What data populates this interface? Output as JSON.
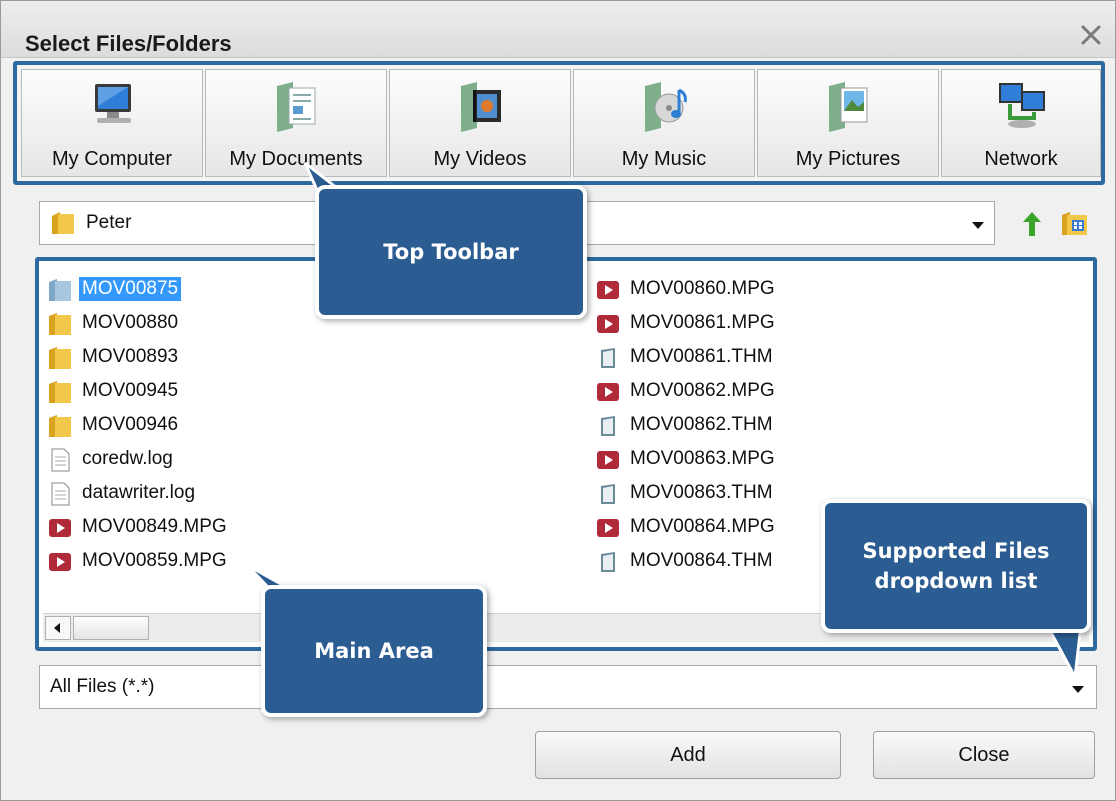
{
  "window": {
    "title": "Select Files/Folders"
  },
  "toolbar": {
    "items": [
      {
        "label": "My Computer",
        "icon": "computer-icon"
      },
      {
        "label": "My Documents",
        "icon": "documents-icon"
      },
      {
        "label": "My Videos",
        "icon": "videos-icon"
      },
      {
        "label": "My Music",
        "icon": "music-icon"
      },
      {
        "label": "My Pictures",
        "icon": "pictures-icon"
      },
      {
        "label": "Network",
        "icon": "network-icon"
      }
    ]
  },
  "pathbar": {
    "current_folder": "Peter"
  },
  "files": {
    "column1": [
      {
        "name": "MOV00875",
        "type": "folder",
        "selected": true
      },
      {
        "name": "MOV00880",
        "type": "folder"
      },
      {
        "name": "MOV00893",
        "type": "folder"
      },
      {
        "name": "MOV00945",
        "type": "folder"
      },
      {
        "name": "MOV00946",
        "type": "folder"
      },
      {
        "name": "coredw.log",
        "type": "text"
      },
      {
        "name": "datawriter.log",
        "type": "text"
      },
      {
        "name": "MOV00849.MPG",
        "type": "video"
      },
      {
        "name": "MOV00859.MPG",
        "type": "video"
      }
    ],
    "column2": [
      {
        "name": "MOV00860.MPG",
        "type": "video"
      },
      {
        "name": "MOV00861.MPG",
        "type": "video"
      },
      {
        "name": "MOV00861.THM",
        "type": "thumb"
      },
      {
        "name": "MOV00862.MPG",
        "type": "video"
      },
      {
        "name": "MOV00862.THM",
        "type": "thumb"
      },
      {
        "name": "MOV00863.MPG",
        "type": "video"
      },
      {
        "name": "MOV00863.THM",
        "type": "thumb"
      },
      {
        "name": "MOV00864.MPG",
        "type": "video"
      },
      {
        "name": "MOV00864.THM",
        "type": "thumb"
      }
    ]
  },
  "filter": {
    "value": "All Files (*.*)"
  },
  "buttons": {
    "add": "Add",
    "close": "Close"
  },
  "callouts": {
    "top_toolbar": "Top Toolbar",
    "main_area": "Main Area",
    "supported_files": "Supported Files dropdown list"
  },
  "colors": {
    "accent": "#2e6aa0",
    "callout": "#2b5d92",
    "selection": "#3399ff"
  }
}
